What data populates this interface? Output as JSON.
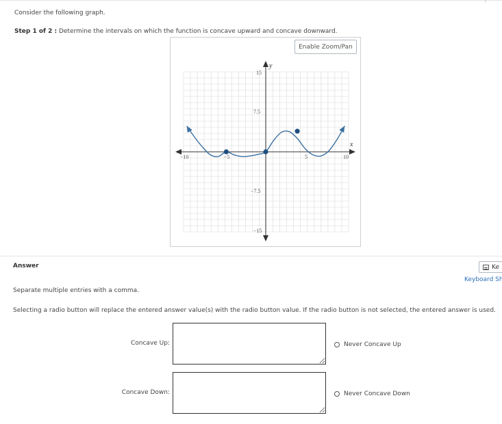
{
  "question": {
    "prompt": "Consider the following graph.",
    "step_label": "Step 1 of 2 :",
    "step_text": "Determine the intervals on which the function is concave upward and concave downward."
  },
  "graph": {
    "zoom_button_label": "Enable Zoom/Pan",
    "x_axis_name": "x",
    "y_axis_name": "y",
    "tick_labels": {
      "x_neg": "−10",
      "x_neg_mid": "−5",
      "x_pos_mid": "5",
      "x_pos": "10",
      "y_pos": "15",
      "y_pos_mid": "7.5",
      "y_neg_mid": "−7.5",
      "y_neg": "−15"
    },
    "points": [
      {
        "x": -5,
        "y": 0
      },
      {
        "x": 0,
        "y": 0
      },
      {
        "x": 4,
        "y": 4
      }
    ],
    "curve_color": "#3b6fa0",
    "point_color": "#1f4f80"
  },
  "answer": {
    "title": "Answer",
    "keyboard_button_fragment": "Ke",
    "keyboard_link_fragment": "Keyboard Sh",
    "hint_multiple": "Separate multiple entries with a comma.",
    "hint_radio": "Selecting a radio button will replace the entered answer value(s) with the radio button value. If the radio button is not selected, the entered answer is used.",
    "fields": [
      {
        "label": "Concave Up:",
        "value": "",
        "radio_label": "Never Concave Up"
      },
      {
        "label": "Concave Down:",
        "value": "",
        "radio_label": "Never Concave Down"
      }
    ]
  }
}
